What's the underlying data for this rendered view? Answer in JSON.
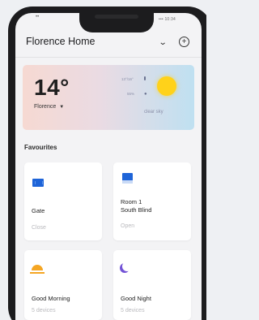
{
  "status_bar": {
    "left_text": "••",
    "right_text": "••• 10:34"
  },
  "header": {
    "home_name": "Florence Home",
    "chevron_icon": "chevron-down-icon",
    "add_icon": "add-circle-icon"
  },
  "weather": {
    "temperature": "14°",
    "location": "Florence",
    "location_arrow": "▼",
    "stat_1": "13°/16°",
    "stat_2": "55%",
    "description": "clear sky",
    "icon": "sun-icon",
    "colors": {
      "gradient_start": "#f6d9d2",
      "gradient_end": "#bfe0f1",
      "sun": "#ffd21a"
    }
  },
  "favourites": {
    "title": "Favourites",
    "items": [
      {
        "name": "Gate",
        "status": "Close",
        "icon": "gate-icon"
      },
      {
        "name": "Room 1\nSouth Blind",
        "status": "Open",
        "icon": "blind-icon"
      },
      {
        "name": "Good Morning",
        "status": "5 devices",
        "icon": "sunrise-icon"
      },
      {
        "name": "Good Night",
        "status": "5 devices",
        "icon": "moon-icon"
      }
    ]
  },
  "colors": {
    "accent_blue": "#1e64d8",
    "accent_orange": "#f5a623",
    "accent_purple": "#7353d6",
    "background": "#f3f3f5",
    "phone_frame": "#1c1c1e"
  }
}
